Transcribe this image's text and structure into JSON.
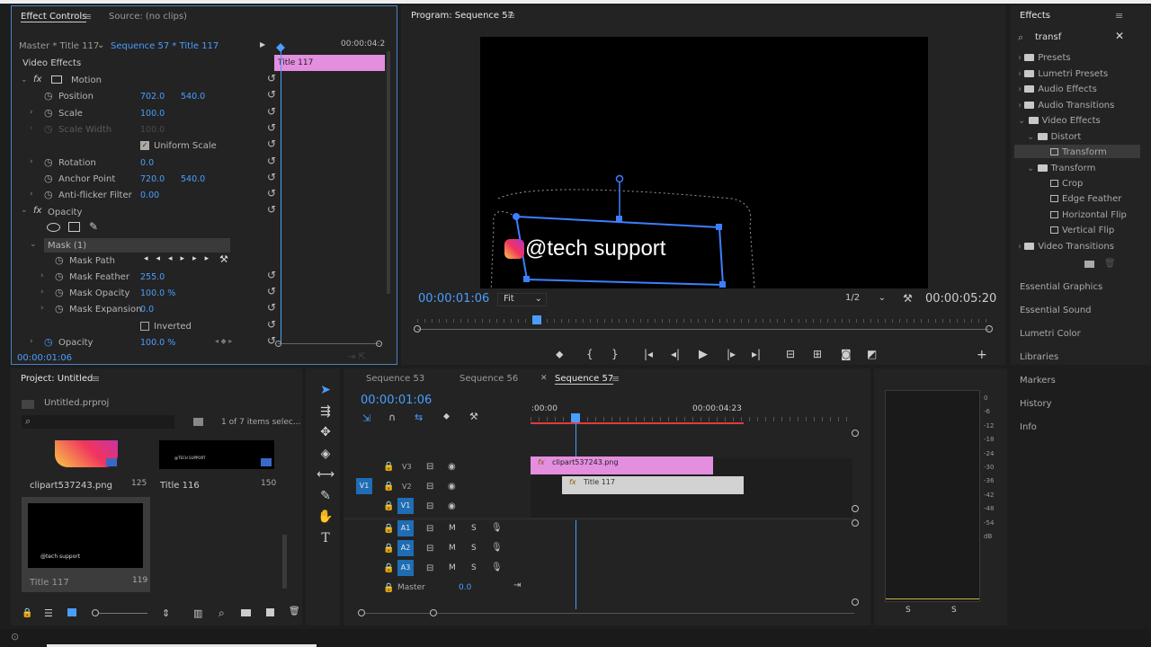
{
  "effect_controls": {
    "tab_active": "Effect Controls",
    "tab_source": "Source: (no clips)",
    "master_label": "Master * Title 117",
    "sequence_label": "Sequence 57 * Title 117",
    "time_end": "00:00:04:2",
    "clip_label": "Title 117",
    "section": "Video Effects",
    "motion": "Motion",
    "position_label": "Position",
    "position_x": "702.0",
    "position_y": "540.0",
    "scale_label": "Scale",
    "scale_val": "100.0",
    "scale_width_label": "Scale Width",
    "scale_width_val": "100.0",
    "uniform_scale": "Uniform Scale",
    "rotation_label": "Rotation",
    "rotation_val": "0.0",
    "anchor_label": "Anchor Point",
    "anchor_x": "720.0",
    "anchor_y": "540.0",
    "flicker_label": "Anti-flicker Filter",
    "flicker_val": "0.00",
    "opacity_group": "Opacity",
    "mask_label": "Mask (1)",
    "mask_path": "Mask Path",
    "mask_feather": "Mask Feather",
    "mask_feather_val": "255.0",
    "mask_opacity": "Mask Opacity",
    "mask_opacity_val": "100.0 %",
    "mask_expansion": "Mask Expansion",
    "mask_expansion_val": "0.0",
    "inverted": "Inverted",
    "opacity_label": "Opacity",
    "opacity_val": "100.0 %",
    "timecode": "00:00:01:06"
  },
  "program": {
    "title": "Program: Sequence 57",
    "overlay_text": "@tech support",
    "timecode": "00:00:01:06",
    "fit": "Fit",
    "resolution": "1/2",
    "duration": "00:00:05:20"
  },
  "effects": {
    "title": "Effects",
    "search_value": "transf",
    "items": [
      {
        "label": "Presets"
      },
      {
        "label": "Lumetri Presets"
      },
      {
        "label": "Audio Effects"
      },
      {
        "label": "Audio Transitions"
      },
      {
        "label": "Video Effects"
      },
      {
        "label": "Distort"
      },
      {
        "label": "Transform"
      },
      {
        "label": "Transform"
      },
      {
        "label": "Crop"
      },
      {
        "label": "Edge Feather"
      },
      {
        "label": "Horizontal Flip"
      },
      {
        "label": "Vertical Flip"
      },
      {
        "label": "Video Transitions"
      }
    ],
    "side_panels": [
      "Essential Graphics",
      "Essential Sound",
      "Lumetri Color",
      "Libraries",
      "Markers",
      "History",
      "Info"
    ]
  },
  "project": {
    "title": "Project: Untitled",
    "file": "Untitled.prproj",
    "items_count": "1 of 7 items selec...",
    "clips": [
      {
        "name": "clipart537243.png",
        "dur": "125"
      },
      {
        "name": "Title 116",
        "dur": "150"
      },
      {
        "name": "Title 117",
        "dur": "119"
      }
    ],
    "thumb_text_116": "@TECH SUPPORT",
    "thumb_text_117": "@tech support"
  },
  "timeline": {
    "tabs": [
      "Sequence 53",
      "Sequence 56",
      "Sequence 57"
    ],
    "timecode": "00:00:01:06",
    "ruler_start": ":00:00",
    "ruler_mark": "00:00:04:23",
    "tracks": [
      "V3",
      "V2",
      "V1",
      "A1",
      "A2",
      "A3"
    ],
    "source_v": "V1",
    "master": "Master",
    "master_val": "0.0",
    "clip_v3": "clipart537243.png",
    "clip_v2": "Title 117",
    "fx": "fx",
    "mute": "M",
    "solo": "S"
  },
  "meters": {
    "scale": [
      "0",
      "-6",
      "-12",
      "-18",
      "-24",
      "-30",
      "-36",
      "-42",
      "-48",
      "-54",
      "dB"
    ],
    "solo_l": "S",
    "solo_r": "S"
  },
  "colors": {
    "accent": "#4a9eff",
    "clip_pink": "#e48ee0",
    "clip_gray": "#d2d2d2",
    "track_blue": "#1f6db5",
    "playhead": "#4a9eff",
    "work_area": "#e23a3a"
  }
}
